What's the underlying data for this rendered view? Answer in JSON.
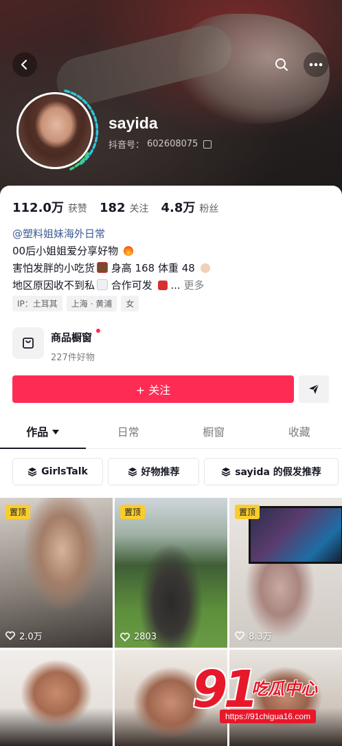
{
  "header": {
    "nickname": "sayida",
    "douyin_id_label": "抖音号：",
    "douyin_id": "602608075"
  },
  "stats": [
    {
      "value": "112.0万",
      "label": "获赞"
    },
    {
      "value": "182",
      "label": "关注"
    },
    {
      "value": "4.8万",
      "label": "粉丝"
    }
  ],
  "bio": {
    "mention": "@塑料姐妹海外日常",
    "line1": "00后小姐姐爱分享好物",
    "line2a": "害怕发胖的小吃货",
    "line2b": " 身高 168 体重 48",
    "line3a": "地区原因收不到私",
    "line3b": " 合作可发",
    "line3c": " ...",
    "more": "更多"
  },
  "tags": [
    "IP：土耳其",
    "上海 · 黄浦",
    "女"
  ],
  "shop": {
    "title": "商品橱窗",
    "subtitle": "227件好物"
  },
  "follow_label": "+ 关注",
  "tabs": [
    "作品",
    "日常",
    "橱窗",
    "收藏"
  ],
  "collections": [
    "GirlsTalk",
    "好物推荐",
    "sayida 的假发推荐"
  ],
  "videos": [
    {
      "pinned": "置顶",
      "likes": "2.0万"
    },
    {
      "pinned": "置顶",
      "likes": "2803"
    },
    {
      "pinned": "置顶",
      "likes": "8.3万"
    },
    {
      "pinned": "",
      "likes": ""
    },
    {
      "pinned": "",
      "likes": ""
    },
    {
      "pinned": "",
      "likes": ""
    }
  ],
  "watermark": {
    "number": "91",
    "name": "吃瓜中心",
    "url": "https://91chigua16.com"
  },
  "colors": {
    "accent": "#fe2c55",
    "pin": "#facd2c",
    "watermark": "#e8182b"
  }
}
